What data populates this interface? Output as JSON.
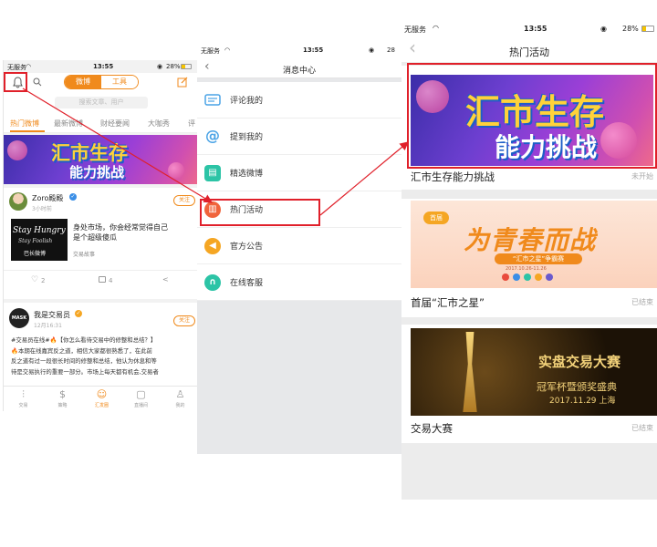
{
  "screen1": {
    "status": {
      "carrier": "无服务",
      "time": "13:55",
      "battery": "28%"
    },
    "segment": {
      "left": "微博",
      "right": "工具"
    },
    "search_placeholder": "搜索文章、用户",
    "tabs": [
      "热门微博",
      "最新微博",
      "财经要闻",
      "大咖秀",
      "评"
    ],
    "banner": {
      "line1": "汇市生存",
      "line2": "能力挑战"
    },
    "post1": {
      "author": "Zoro殿殿",
      "time": "3小时前",
      "follow": "关注",
      "thumb_text1": "Stay Hungry",
      "thumb_text2": "Stay Foolish",
      "thumb_text3": "巴长微博",
      "content": "身处市场，你会经常觉得自己是个超级傻瓜",
      "source": "交易故事",
      "likes": "2",
      "comments": "4"
    },
    "post2": {
      "author": "我是交易员",
      "time": "12月16:31",
      "follow": "关注",
      "avatar_text": "MASK",
      "line1": "#交易员在线#🔥【你怎么看待交易中的修整和总结？】",
      "line2": "🔥本期在线嘉宾反之道，相信大家都很熟悉了，在此前",
      "line3": "反之道有过一段很长时间的修整和总结，他认为休息和等",
      "line4": "待是交易执行的重要一部分。市场上每天都有机会,交易者"
    },
    "tabbar": [
      "交易",
      "策略",
      "汇发圈",
      "直播间",
      "我的"
    ]
  },
  "screen2": {
    "status": {
      "carrier": "无服务",
      "time": "13:55",
      "battery": "28"
    },
    "title": "消息中心",
    "items": [
      {
        "label": "评论我的",
        "icon": "comment-icon",
        "color": "#4aa3e6"
      },
      {
        "label": "提到我的",
        "icon": "at-icon",
        "color": "#4aa3e6"
      },
      {
        "label": "精选微博",
        "icon": "document-icon",
        "color": "#2cc4a6"
      },
      {
        "label": "热门活动",
        "icon": "gift-icon",
        "color": "#f0643c"
      },
      {
        "label": "官方公告",
        "icon": "megaphone-icon",
        "color": "#f5a623"
      },
      {
        "label": "在线客服",
        "icon": "headset-icon",
        "color": "#2cc4a6"
      }
    ]
  },
  "screen3": {
    "status": {
      "carrier": "无服务",
      "time": "13:55",
      "battery": "28%"
    },
    "title": "热门活动",
    "cards": [
      {
        "title": "汇市生存能力挑战",
        "status": "未开始",
        "banner_line1": "汇市生存",
        "banner_line2": "能力挑战"
      },
      {
        "title": "首届“汇市之星”",
        "status": "已结束",
        "banner_main": "为青春而战",
        "banner_sub": "“汇市之星”争霸赛",
        "banner_date": "2017.10.26-11.26",
        "badge": "首届"
      },
      {
        "title": "交易大赛",
        "status": "已结束",
        "banner_main": "实盘交易大赛",
        "banner_sub": "冠军杯暨颁奖盛典",
        "banner_date": "2017.11.29 上海"
      }
    ]
  },
  "colors": {
    "accent": "#f08a1c",
    "annotation": "#e0202a"
  }
}
